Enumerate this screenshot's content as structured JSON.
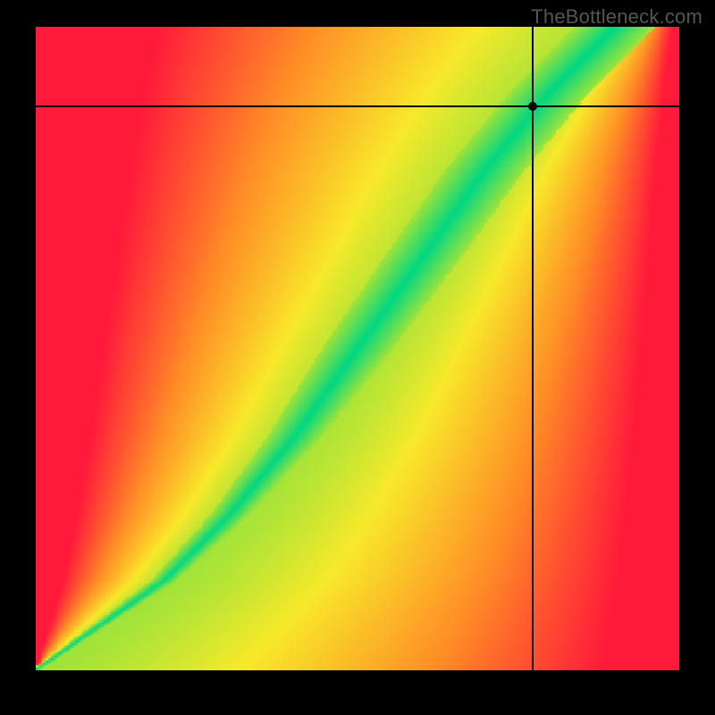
{
  "watermark": "TheBottleneck.com",
  "chart_data": {
    "type": "heatmap",
    "title": "",
    "xlabel": "",
    "ylabel": "",
    "x_range": [
      0,
      1
    ],
    "y_range": [
      0,
      1
    ],
    "grid": false,
    "color_stops": [
      {
        "t": 0.0,
        "color": "#00d782"
      },
      {
        "t": 0.2,
        "color": "#9fe33a"
      },
      {
        "t": 0.4,
        "color": "#f8e92a"
      },
      {
        "t": 0.7,
        "color": "#ff8c26"
      },
      {
        "t": 1.0,
        "color": "#ff1a3a"
      }
    ],
    "ridge_points_norm": [
      {
        "x": 0.0,
        "y": 0.0,
        "width": 0.006
      },
      {
        "x": 0.1,
        "y": 0.07,
        "width": 0.012
      },
      {
        "x": 0.2,
        "y": 0.14,
        "width": 0.02
      },
      {
        "x": 0.3,
        "y": 0.24,
        "width": 0.03
      },
      {
        "x": 0.4,
        "y": 0.36,
        "width": 0.042
      },
      {
        "x": 0.5,
        "y": 0.5,
        "width": 0.055
      },
      {
        "x": 0.6,
        "y": 0.64,
        "width": 0.06
      },
      {
        "x": 0.7,
        "y": 0.78,
        "width": 0.062
      },
      {
        "x": 0.8,
        "y": 0.9,
        "width": 0.062
      },
      {
        "x": 0.9,
        "y": 1.0,
        "width": 0.062
      }
    ],
    "crosshair_norm": {
      "x": 0.772,
      "y": 0.876
    },
    "marker_norm": {
      "x": 0.772,
      "y": 0.876
    },
    "resolution": 256
  }
}
